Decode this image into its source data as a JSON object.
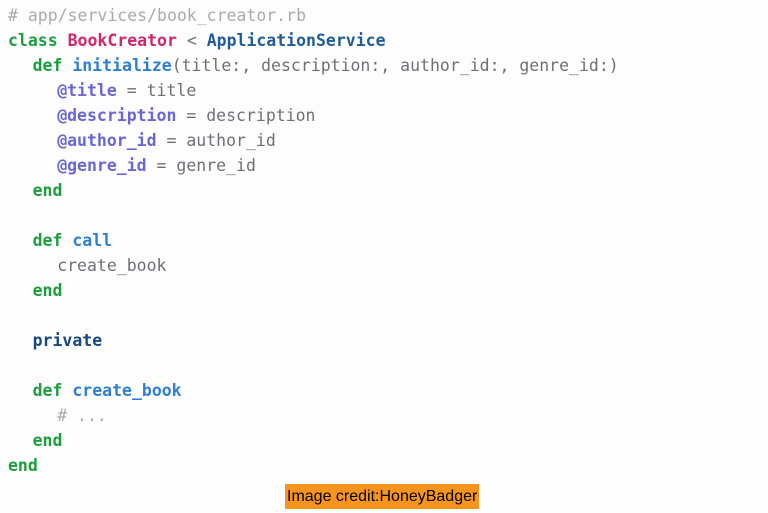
{
  "code": {
    "language": "ruby",
    "file_comment": "# app/services/book_creator.rb",
    "background_color": "#fdfdfd",
    "lines": [
      {
        "indent": 0,
        "tokens": [
          {
            "text": "# app/services/book_creator.rb",
            "kind": "comment"
          }
        ]
      },
      {
        "indent": 0,
        "tokens": [
          {
            "text": "class",
            "kind": "keyword"
          },
          {
            "text": " ",
            "kind": "plain"
          },
          {
            "text": "BookCreator",
            "kind": "class"
          },
          {
            "text": " ",
            "kind": "plain"
          },
          {
            "text": "<",
            "kind": "op"
          },
          {
            "text": " ",
            "kind": "plain"
          },
          {
            "text": "ApplicationService",
            "kind": "const"
          }
        ]
      },
      {
        "indent": 2,
        "tokens": [
          {
            "text": "def",
            "kind": "keyword"
          },
          {
            "text": " ",
            "kind": "plain"
          },
          {
            "text": "initialize",
            "kind": "method"
          },
          {
            "text": "(title:, description:, author_id:, genre_id:)",
            "kind": "plain"
          }
        ]
      },
      {
        "indent": 4,
        "tokens": [
          {
            "text": "@title",
            "kind": "ivar"
          },
          {
            "text": " ",
            "kind": "plain"
          },
          {
            "text": "=",
            "kind": "op"
          },
          {
            "text": " ",
            "kind": "plain"
          },
          {
            "text": "title",
            "kind": "plain"
          }
        ]
      },
      {
        "indent": 4,
        "tokens": [
          {
            "text": "@description",
            "kind": "ivar"
          },
          {
            "text": " ",
            "kind": "plain"
          },
          {
            "text": "=",
            "kind": "op"
          },
          {
            "text": " ",
            "kind": "plain"
          },
          {
            "text": "description",
            "kind": "plain"
          }
        ]
      },
      {
        "indent": 4,
        "tokens": [
          {
            "text": "@author_id",
            "kind": "ivar"
          },
          {
            "text": " ",
            "kind": "plain"
          },
          {
            "text": "=",
            "kind": "op"
          },
          {
            "text": " ",
            "kind": "plain"
          },
          {
            "text": "author_id",
            "kind": "plain"
          }
        ]
      },
      {
        "indent": 4,
        "tokens": [
          {
            "text": "@genre_id",
            "kind": "ivar"
          },
          {
            "text": " ",
            "kind": "plain"
          },
          {
            "text": "=",
            "kind": "op"
          },
          {
            "text": " ",
            "kind": "plain"
          },
          {
            "text": "genre_id",
            "kind": "plain"
          }
        ]
      },
      {
        "indent": 2,
        "tokens": [
          {
            "text": "end",
            "kind": "keyword"
          }
        ]
      },
      {
        "indent": 0,
        "tokens": []
      },
      {
        "indent": 2,
        "tokens": [
          {
            "text": "def",
            "kind": "keyword"
          },
          {
            "text": " ",
            "kind": "plain"
          },
          {
            "text": "call",
            "kind": "method"
          }
        ]
      },
      {
        "indent": 4,
        "tokens": [
          {
            "text": "create_book",
            "kind": "plain"
          }
        ]
      },
      {
        "indent": 2,
        "tokens": [
          {
            "text": "end",
            "kind": "keyword"
          }
        ]
      },
      {
        "indent": 0,
        "tokens": []
      },
      {
        "indent": 2,
        "tokens": [
          {
            "text": "private",
            "kind": "private"
          }
        ]
      },
      {
        "indent": 0,
        "tokens": []
      },
      {
        "indent": 2,
        "tokens": [
          {
            "text": "def",
            "kind": "keyword"
          },
          {
            "text": " ",
            "kind": "plain"
          },
          {
            "text": "create_book",
            "kind": "method"
          }
        ]
      },
      {
        "indent": 4,
        "tokens": [
          {
            "text": "# ...",
            "kind": "comment"
          }
        ]
      },
      {
        "indent": 2,
        "tokens": [
          {
            "text": "end",
            "kind": "keyword"
          }
        ]
      },
      {
        "indent": 0,
        "tokens": [
          {
            "text": "end",
            "kind": "keyword"
          }
        ]
      }
    ],
    "colors": {
      "comment": "#a8aab0",
      "keyword": "#1a9e3c",
      "class": "#d1266b",
      "const": "#1f5c99",
      "method": "#2e7fd4",
      "ivar": "#6b66d6",
      "plain": "#6e7076",
      "private": "#14487e"
    }
  },
  "credit": {
    "text": "Image credit:HoneyBadger",
    "background_color": "#f7941e",
    "text_color": "#000000"
  }
}
